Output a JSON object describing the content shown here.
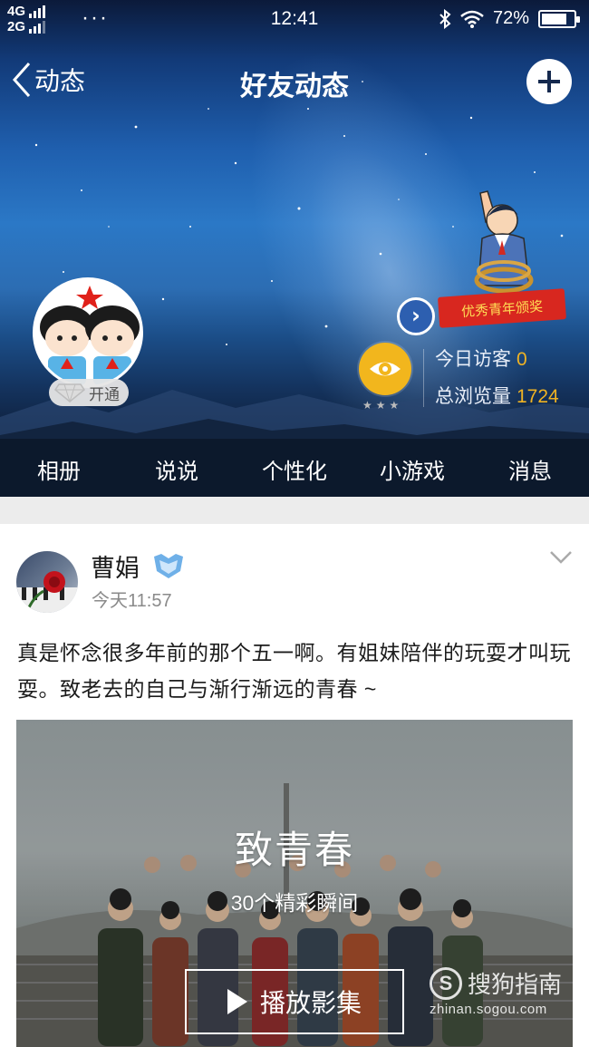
{
  "status_bar": {
    "net_top": "4G",
    "net_bottom": "2G",
    "dots": "···",
    "time": "12:41",
    "battery": "72%"
  },
  "nav": {
    "back_label": "动态",
    "title": "好友动态"
  },
  "profile": {
    "open_badge": "开通",
    "award_text": "优秀青年颁奖",
    "visitors_today_label": "今日访客",
    "visitors_today": "0",
    "total_views_label": "总浏览量",
    "total_views": "1724"
  },
  "tabs": [
    "相册",
    "说说",
    "个性化",
    "小游戏",
    "消息"
  ],
  "post": {
    "author": "曹娟",
    "time": "今天11:57",
    "text": "真是怀念很多年前的那个五一啊。有姐妹陪伴的玩耍才叫玩耍。致老去的自己与渐行渐远的青春 ~",
    "video": {
      "title": "致青春",
      "subtitle": "30个精彩瞬间",
      "play_label": "播放影集"
    }
  },
  "watermark": {
    "logo": "S",
    "name": "搜狗指南",
    "url": "zhinan.sogou.com"
  },
  "colors": {
    "accent_gold": "#f0b323",
    "eye_button": "#f2b61d",
    "award_blue": "#2d5fb0"
  }
}
